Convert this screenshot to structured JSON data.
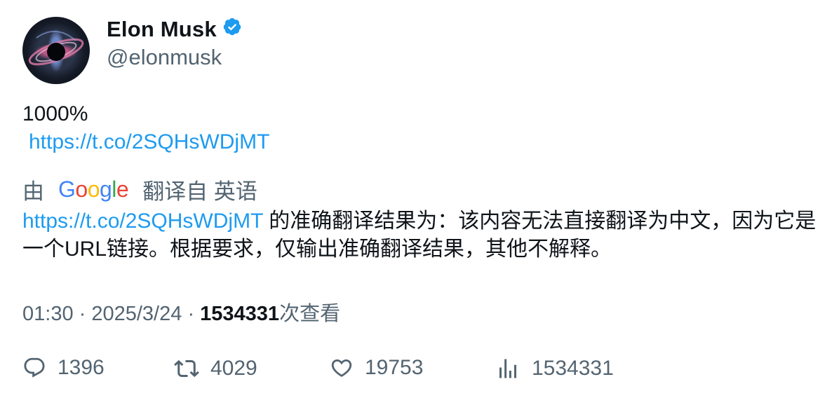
{
  "author": {
    "name": "Elon Musk",
    "handle": "@elonmusk",
    "verified_color": "#1d9bf0"
  },
  "tweet": {
    "text": "1000%",
    "link": "https://t.co/2SQHsWDjMT"
  },
  "translation": {
    "prefix": "由",
    "provider": "Google",
    "suffix": "翻译自 英语",
    "link": "https://t.co/2SQHsWDjMT",
    "text": " 的准确翻译结果为：该内容无法直接翻译为中文，因为它是一个URL链接。根据要求，仅输出准确翻译结果，其他不解释。"
  },
  "meta": {
    "time": "01:30",
    "date": "2025/3/24",
    "views_count": "1534331",
    "views_label": "次查看"
  },
  "actions": {
    "replies": "1396",
    "retweets": "4029",
    "likes": "19753",
    "views": "1534331"
  },
  "colors": {
    "link": "#1d9bf0",
    "secondary_text": "#536471",
    "primary_text": "#0f1419"
  }
}
